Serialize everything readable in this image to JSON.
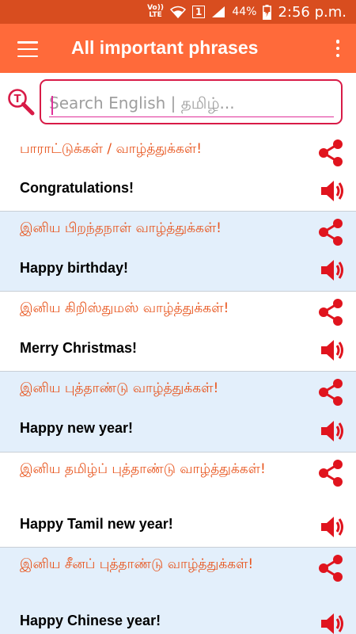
{
  "status_bar": {
    "volte_line1": "Vo))",
    "volte_line2": "LTE",
    "sim_slot": "1",
    "battery": "44%",
    "time": "2:56 p.m."
  },
  "app_bar": {
    "title": "All important phrases"
  },
  "search": {
    "placeholder": "Search English | தமிழ்..."
  },
  "colors": {
    "accent": "#ff6a3a",
    "status_bar": "#d84d1f",
    "tamil_text": "#e8561f",
    "icon_red": "#e0141e",
    "search_border": "#d81b47",
    "alt_row": "#e3effb"
  },
  "phrases": [
    {
      "tamil": "பாராட்டுக்கள் / வாழ்த்துக்கள்!",
      "english": "Congratulations!"
    },
    {
      "tamil": "இனிய பிறந்தநாள் வாழ்த்துக்கள்!",
      "english": "Happy birthday!"
    },
    {
      "tamil": "இனிய கிறிஸ்துமஸ் வாழ்த்துக்கள்!",
      "english": "Merry Christmas!"
    },
    {
      "tamil": "இனிய புத்தாண்டு வாழ்த்துக்கள்!",
      "english": "Happy new year!"
    },
    {
      "tamil": "இனிய தமிழ்ப் புத்தாண்டு வாழ்த்துக்கள்!",
      "english": "Happy Tamil new year!"
    },
    {
      "tamil": "இனிய சீனப் புத்தாண்டு வாழ்த்துக்கள்!",
      "english": "Happy Chinese year!"
    }
  ]
}
